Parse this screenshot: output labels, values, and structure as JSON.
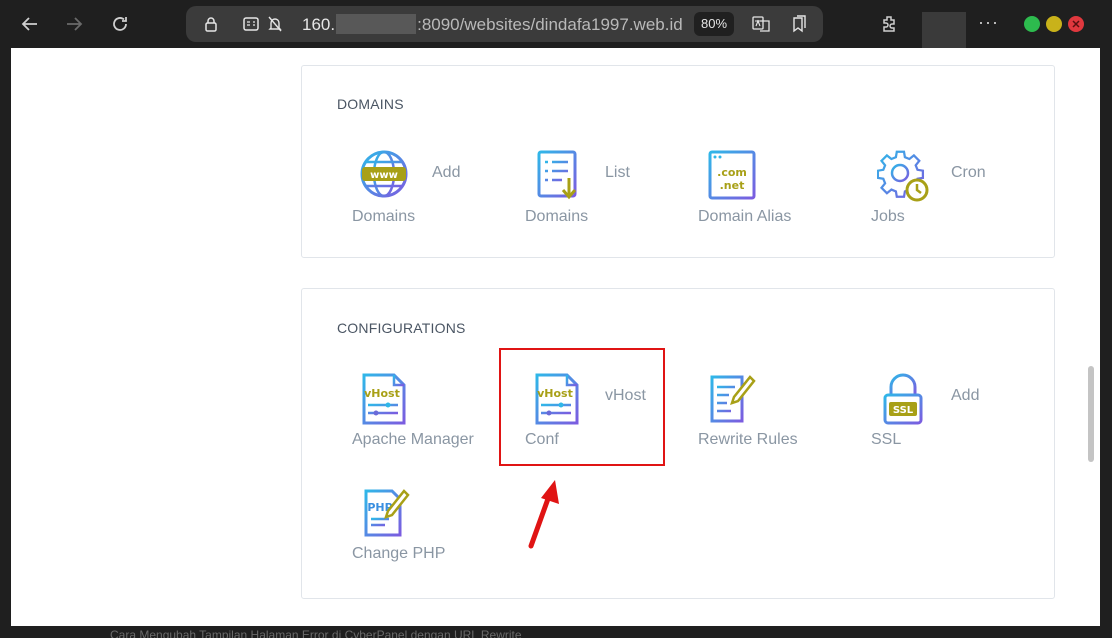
{
  "browser": {
    "url_prefix": "160.",
    "url_suffix": ":8090/websites/dindafa1997.web.id",
    "zoom": "80%"
  },
  "sections": {
    "domains": {
      "title": "DOMAINS",
      "tiles": [
        {
          "side": "Add",
          "bottom": "Domains",
          "icon": "www-globe-icon"
        },
        {
          "side": "List",
          "bottom": "Domains",
          "icon": "list-document-icon"
        },
        {
          "side": "",
          "bottom": "Domain Alias",
          "icon": "com-net-browser-icon"
        },
        {
          "side": "Cron",
          "bottom": "Jobs",
          "icon": "gear-clock-icon"
        }
      ]
    },
    "configurations": {
      "title": "CONFIGURATIONS",
      "tiles": [
        {
          "side": "",
          "bottom": "Apache Manager",
          "icon": "vhost-file-icon",
          "icon_text": "vHost"
        },
        {
          "side": "vHost",
          "bottom": "Conf",
          "icon": "vhost-file-icon",
          "icon_text": "vHost"
        },
        {
          "side": "",
          "bottom": "Rewrite Rules",
          "icon": "edit-document-icon"
        },
        {
          "side": "Add",
          "bottom": "SSL",
          "icon": "ssl-lock-icon",
          "icon_text": "SSL"
        },
        {
          "side": "",
          "bottom": "Change PHP",
          "icon": "php-edit-icon",
          "icon_text": "PHP"
        }
      ]
    }
  },
  "icon_labels": {
    "www": "www",
    "com": ".com",
    "net": ".net"
  },
  "colors": {
    "icon_gradient_start": "#2fb7e8",
    "icon_gradient_end": "#7b5ce0",
    "icon_accent": "#a8a017",
    "label": "#8a96a3",
    "highlight": "#e01414"
  },
  "footer_text": "Cara Mengubah Tampilan Halaman Error di CyberPanel dengan URL Rewrite"
}
